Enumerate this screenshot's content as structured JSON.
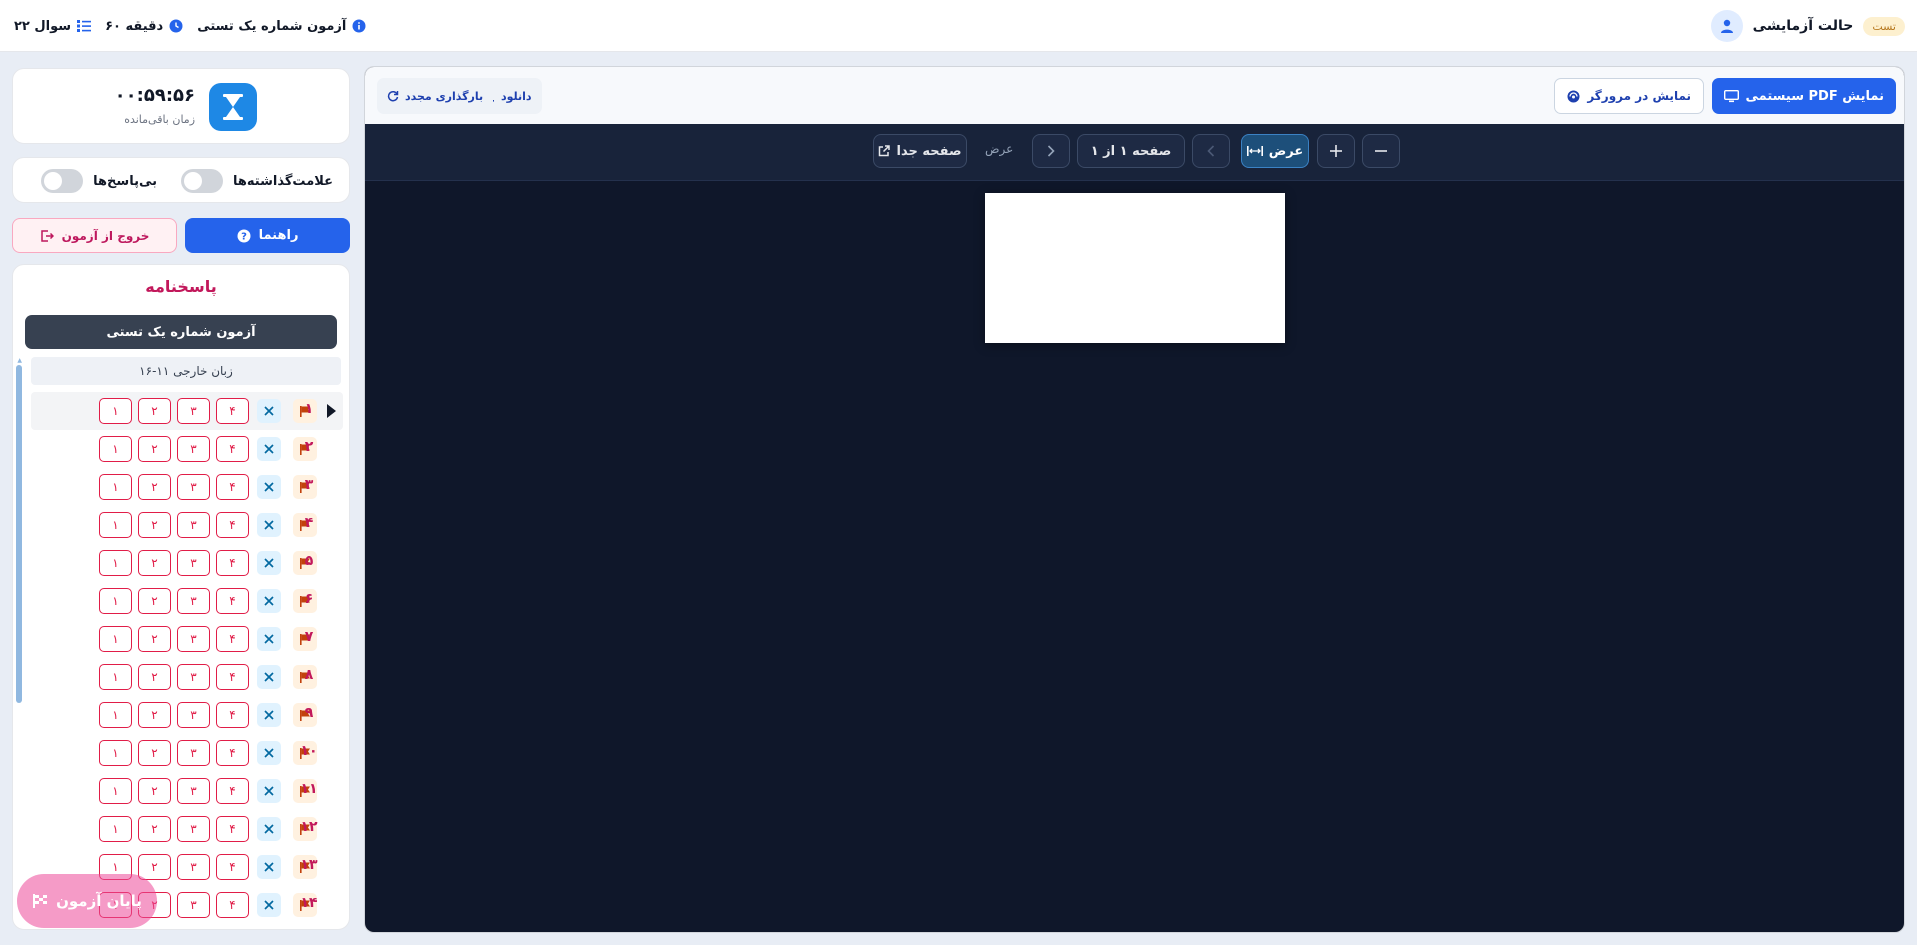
{
  "topbar": {
    "mode_label": "حالت آزمایشی",
    "test_badge": "تست",
    "exam_title": "آزمون شماره یک تستی",
    "duration": "۶۰ دقیقه",
    "question_count": "۲۲ سوال"
  },
  "timer": {
    "value": "۰۰:۵۹:۵۶",
    "label": "زمان باقی‌مانده"
  },
  "toggles": {
    "marked_label": "علامت‌گذاشته‌ها",
    "unanswered_label": "بی‌پاسخ‌ها",
    "marked_on": false,
    "unanswered_on": false
  },
  "actions": {
    "guide_label": "راهنما",
    "exit_label": "خروج از آزمون",
    "finish_label": "پایان آزمون"
  },
  "answer_sheet": {
    "title": "پاسخنامه",
    "exam_name": "آزمون شماره یک تستی",
    "section": "زبان خارجی ۱۱-۱۶",
    "options": [
      "۴",
      "۳",
      "۲",
      "۱"
    ],
    "current_question": 1,
    "questions": [
      "۱",
      "۲",
      "۳",
      "۴",
      "۵",
      "۶",
      "۷",
      "۸",
      "۹",
      "۱۰",
      "۱۱",
      "۱۲",
      "۱۳",
      "۱۴"
    ]
  },
  "viewer": {
    "system_pdf_label": "نمایش PDF سیستمی",
    "browser_label": "نمایش در مرورگر",
    "download_label": "دانلود",
    "reload_label": "بارگذاری مجدد",
    "fit_width_label": "عرض",
    "page_indicator": "صفحه ۱ از ۱",
    "fit_mode_text": "عرض",
    "separate_page_label": "صفحه جدا"
  },
  "colors": {
    "primary": "#2563eb",
    "accent_pink": "#c2185b",
    "viewer_bg": "#0f172a"
  }
}
